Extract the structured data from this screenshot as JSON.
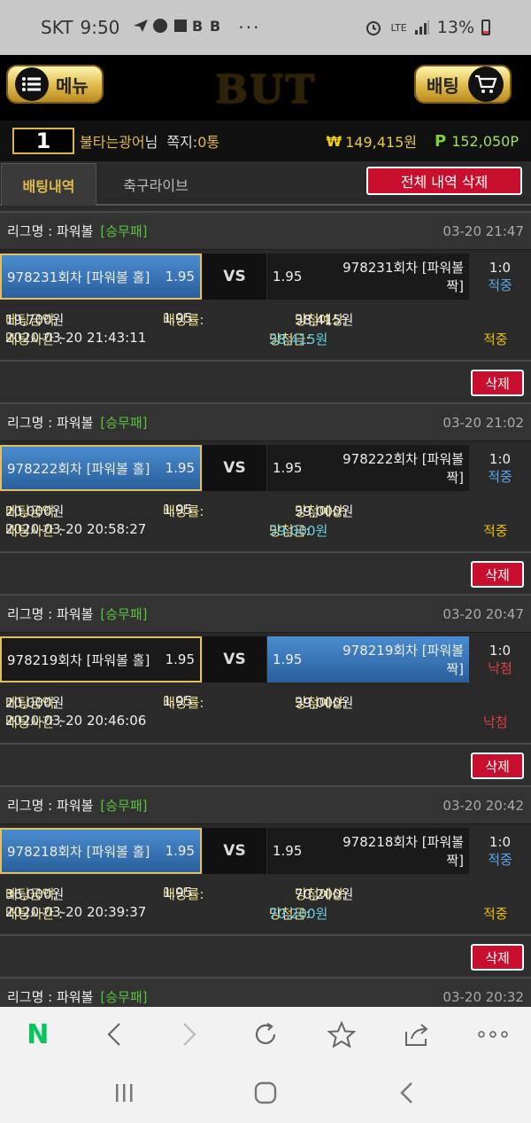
{
  "status_bar": {
    "carrier": "SKT",
    "time": "9:50",
    "battery": "13%",
    "network": "LTE"
  },
  "header": {
    "menu_label": "메뉴",
    "bet_label": "배팅",
    "logo": "BUT"
  },
  "user": {
    "rank": "1",
    "nickname": "불타는광어",
    "nickname_suffix": "님",
    "memo_label": "쪽지:",
    "memo_count": "0통",
    "balance": "149,415원",
    "points": "152,050P",
    "won_symbol": "₩",
    "point_symbol": "P"
  },
  "tabs": {
    "active": "배팅내역",
    "inactive": "축구라이브",
    "delete_all": "전체 내역 삭제"
  },
  "labels": {
    "league": "리그명 : 파워볼",
    "league_type": "[승무패]",
    "vs": "VS",
    "amount": "베팅금액:",
    "odds": "배당률:",
    "expected": "당첨예상:",
    "bet_time": "배팅시간 :",
    "won": "당첨금:",
    "delete": "삭제"
  },
  "bets": [
    {
      "time": "03-20 21:47",
      "home": "978231회차 [파워볼 홀]",
      "home_odds": "1.95",
      "away": "978231회차 [파워볼 짝]",
      "away_odds": "1.95",
      "selected": "home",
      "score": "1:0",
      "result": "적중",
      "amount": "19,700원",
      "odds": "1.95",
      "expected": "38,415원",
      "bet_time": "2020-03-20 21:43:11",
      "win_amount": "38,415원",
      "final": "적중"
    },
    {
      "time": "03-20 21:02",
      "home": "978222회차 [파워볼 홀]",
      "home_odds": "1.95",
      "away": "978222회차 [파워볼 짝]",
      "away_odds": "1.95",
      "selected": "home",
      "score": "1:0",
      "result": "적중",
      "amount": "20,000원",
      "odds": "1.95",
      "expected": "39,000원",
      "bet_time": "2020-03-20 20:58:27",
      "win_amount": "39,000원",
      "final": "적중"
    },
    {
      "time": "03-20 20:47",
      "home": "978219회차 [파워볼 홀]",
      "home_odds": "1.95",
      "away": "978219회차 [파워볼 짝]",
      "away_odds": "1.95",
      "selected": "away",
      "score": "1:0",
      "result": "낙첨",
      "amount": "20,000원",
      "odds": "1.95",
      "expected": "39,000원",
      "bet_time": "2020-03-20 20:46:06",
      "win_amount": "",
      "final": "낙첨"
    },
    {
      "time": "03-20 20:42",
      "home": "978218회차 [파워볼 홀]",
      "home_odds": "1.95",
      "away": "978218회차 [파워볼 짝]",
      "away_odds": "1.95",
      "selected": "home",
      "score": "1:0",
      "result": "적중",
      "amount": "36,000원",
      "odds": "1.95",
      "expected": "70,200원",
      "bet_time": "2020-03-20 20:39:37",
      "win_amount": "70,200원",
      "final": "적중"
    },
    {
      "time": "03-20 20:32"
    }
  ],
  "colors": {
    "accent_gold": "#e0b94a",
    "delete_red": "#c8102e",
    "win_blue": "#5aa8e8",
    "lose_red": "#e04040",
    "selected_blue": "#3a78bc",
    "naver_green": "#03c75a"
  },
  "browser": {
    "icons": [
      "naver-n-icon",
      "back-icon",
      "forward-icon",
      "refresh-icon",
      "star-icon",
      "share-icon",
      "more-icon"
    ],
    "naver_label": "N"
  }
}
